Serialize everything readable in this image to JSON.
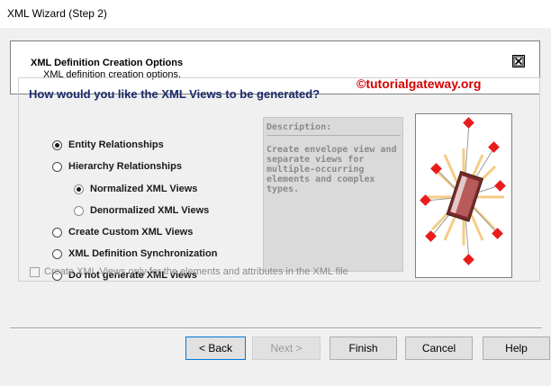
{
  "window": {
    "title": "XML Wizard (Step 2)"
  },
  "header": {
    "title": "XML Definition Creation Options",
    "subtitle": "XML definition creation options."
  },
  "main": {
    "question": "How would you like the XML Views to be generated?",
    "watermark": "©tutorialgateway.org",
    "options": {
      "entity": "Entity Relationships",
      "hierarchy": "Hierarchy Relationships",
      "normalized": "Normalized XML Views",
      "denormalized": "Denormalized XML Views",
      "custom": "Create Custom XML Views",
      "sync": "XML Definition Synchronization",
      "none": "Do not generate XML views"
    },
    "selected": "Entity Relationships",
    "sub_selected": "Normalized XML Views",
    "description": {
      "heading": "Description:",
      "text": "Create envelope view and separate views for multiple-occurring elements and complex types."
    },
    "checkbox_label": "Create XML Views only for the elements and attributes in the XML file",
    "checkbox_checked": false
  },
  "buttons": {
    "back": "< Back",
    "next": "Next >",
    "finish": "Finish",
    "cancel": "Cancel",
    "help": "Help"
  },
  "colors": {
    "question": "#1a2a6a",
    "watermark": "#d40000",
    "diamond": "#e81c1c",
    "focus": "#0078d7"
  }
}
